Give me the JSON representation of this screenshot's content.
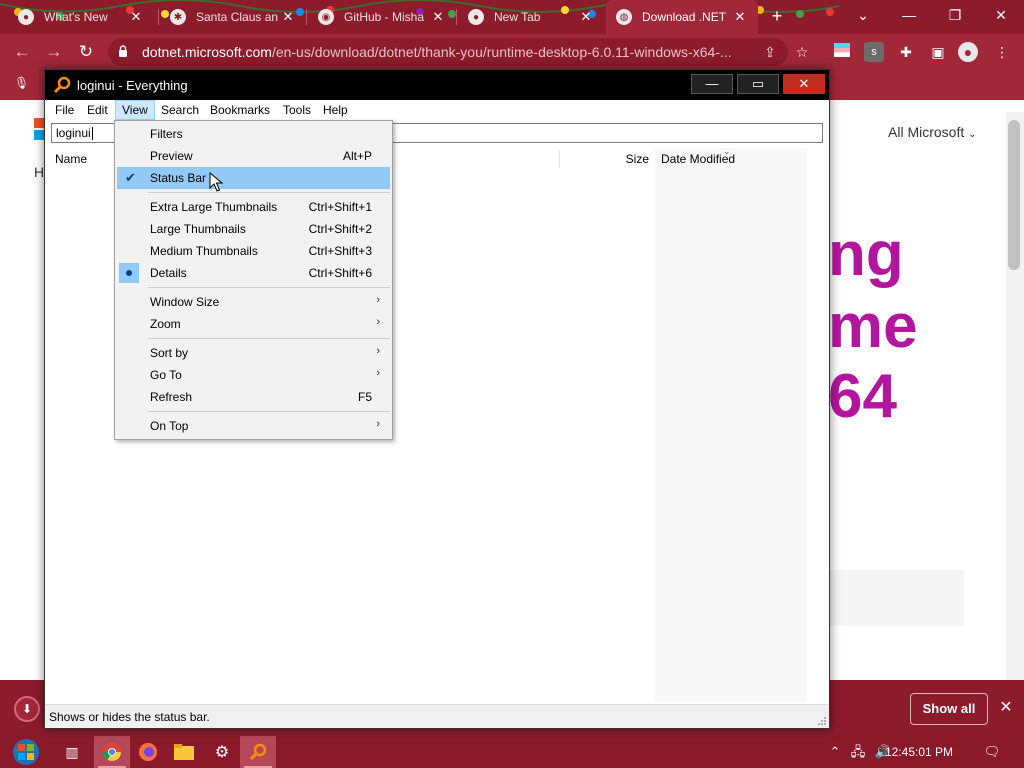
{
  "browser": {
    "tabs": [
      {
        "label": "What's New",
        "active": false
      },
      {
        "label": "Santa Claus an",
        "active": false
      },
      {
        "label": "GitHub - Misha",
        "active": false
      },
      {
        "label": "New Tab",
        "active": false
      },
      {
        "label": "Download .NET",
        "active": true
      }
    ],
    "new_tab_label": "+",
    "url_host": "dotnet.microsoft.com",
    "url_path": "/en-us/download/dotnet/thank-you/runtime-desktop-6.0.11-windows-x64-...",
    "extension_badge": "s"
  },
  "webpage": {
    "header_link": "All Microsoft",
    "heading_lines": [
      "ng",
      "me",
      "64"
    ],
    "left_fragment": "H"
  },
  "downloads_bar": {
    "show_all_label": "Show all",
    "close_label": "✕"
  },
  "everything": {
    "title": "loginui - Everything",
    "menus": [
      "File",
      "Edit",
      "View",
      "Search",
      "Bookmarks",
      "Tools",
      "Help"
    ],
    "open_menu": "View",
    "search_value": "loginui",
    "columns": {
      "name": "Name",
      "size": "Size",
      "date_modified": "Date Modified"
    },
    "status_text": "Shows or hides the status bar."
  },
  "view_menu": {
    "items": [
      {
        "label": "Filters",
        "shortcut": "",
        "submenu": false,
        "mark": "none"
      },
      {
        "label": "Preview",
        "shortcut": "Alt+P",
        "submenu": false,
        "mark": "none"
      },
      {
        "label": "Status Bar",
        "shortcut": "",
        "submenu": false,
        "mark": "check",
        "highlighted": true
      },
      {
        "label": "Extra Large Thumbnails",
        "shortcut": "Ctrl+Shift+1",
        "submenu": false,
        "mark": "none"
      },
      {
        "label": "Large Thumbnails",
        "shortcut": "Ctrl+Shift+2",
        "submenu": false,
        "mark": "none"
      },
      {
        "label": "Medium Thumbnails",
        "shortcut": "Ctrl+Shift+3",
        "submenu": false,
        "mark": "none"
      },
      {
        "label": "Details",
        "shortcut": "Ctrl+Shift+6",
        "submenu": false,
        "mark": "bullet"
      },
      {
        "label": "Window Size",
        "shortcut": "",
        "submenu": true,
        "mark": "none"
      },
      {
        "label": "Zoom",
        "shortcut": "",
        "submenu": true,
        "mark": "none"
      },
      {
        "label": "Sort by",
        "shortcut": "",
        "submenu": true,
        "mark": "none"
      },
      {
        "label": "Go To",
        "shortcut": "",
        "submenu": true,
        "mark": "none"
      },
      {
        "label": "Refresh",
        "shortcut": "F5",
        "submenu": false,
        "mark": "none"
      },
      {
        "label": "On Top",
        "shortcut": "",
        "submenu": true,
        "mark": "none"
      }
    ]
  },
  "taskbar": {
    "clock": "12:45:01 PM",
    "apps": [
      "task-view",
      "chrome",
      "firefox",
      "file-explorer",
      "settings",
      "everything"
    ]
  },
  "colors": {
    "chrome_theme": "#a12739",
    "chrome_tabbar": "#8c1c2c",
    "heading_magenta": "#b3169e",
    "menu_highlight": "#91c9f7"
  }
}
